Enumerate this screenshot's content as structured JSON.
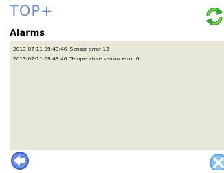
{
  "header": {
    "logo_text": "TOP+",
    "refresh_icon": "refresh-icon"
  },
  "title": "Alarms",
  "alarms": [
    {
      "timestamp": "2013-07-11 09:43:46",
      "message": "Sensor error 12"
    },
    {
      "timestamp": "2013-07-11 09:43:46",
      "message": "Temperature sensor error 6"
    }
  ],
  "footer": {
    "back_icon": "back-arrow-icon",
    "close_icon": "close-icon"
  },
  "colors": {
    "logo": "#6f8fd6",
    "panel": "#e8e8d8",
    "refresh": "#3cb43c",
    "back": "#3a5fc8",
    "close": "#5aa0e0"
  }
}
